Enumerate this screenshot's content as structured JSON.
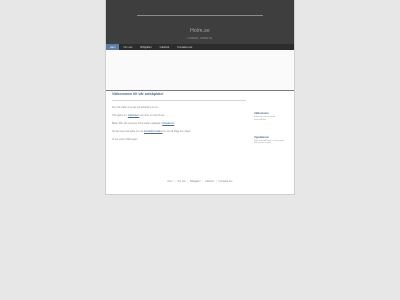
{
  "header": {
    "title": "Holm.se",
    "tagline": "UNDER ARBETE"
  },
  "nav": {
    "items": [
      {
        "label": "Hem",
        "active": true
      },
      {
        "label": "Om oss",
        "active": false
      },
      {
        "label": "Bildgalleri",
        "active": false
      },
      {
        "label": "Gästbok",
        "active": false
      },
      {
        "label": "Kontakta oss",
        "active": false
      }
    ]
  },
  "content": {
    "heading": "Välkommen till vår webbplats!",
    "p1": "Den här sidan är under konstruktion just nu.",
    "p2_pre": "Titta gärna in i ",
    "p2_link": "Gästboken",
    "p2_post": " och skriv en rad till oss.",
    "p3_pre": "Bilder från vår semester finns redan upplagda i ",
    "p3_link": "bildgalleriet",
    "p3_post": ".",
    "p4_pre": "Du kan även kontakta oss via ",
    "p4_link": "kontaktformuläret",
    "p4_post": " om du vill fråga oss något.",
    "p5": "Vi ses snart, hälsningar!"
  },
  "sidebar": {
    "blocks": [
      {
        "title": "Välkommen",
        "text": "Sidan är just nu under konstruktion."
      },
      {
        "title": "Uppdaterad",
        "text": "Nytt innehåll läggs ut inom kort, titta gärna in igen."
      }
    ]
  },
  "footer": {
    "links": [
      "Hem",
      "Om oss",
      "Bildgalleri",
      "Gästbok",
      "Kontakta oss"
    ]
  }
}
